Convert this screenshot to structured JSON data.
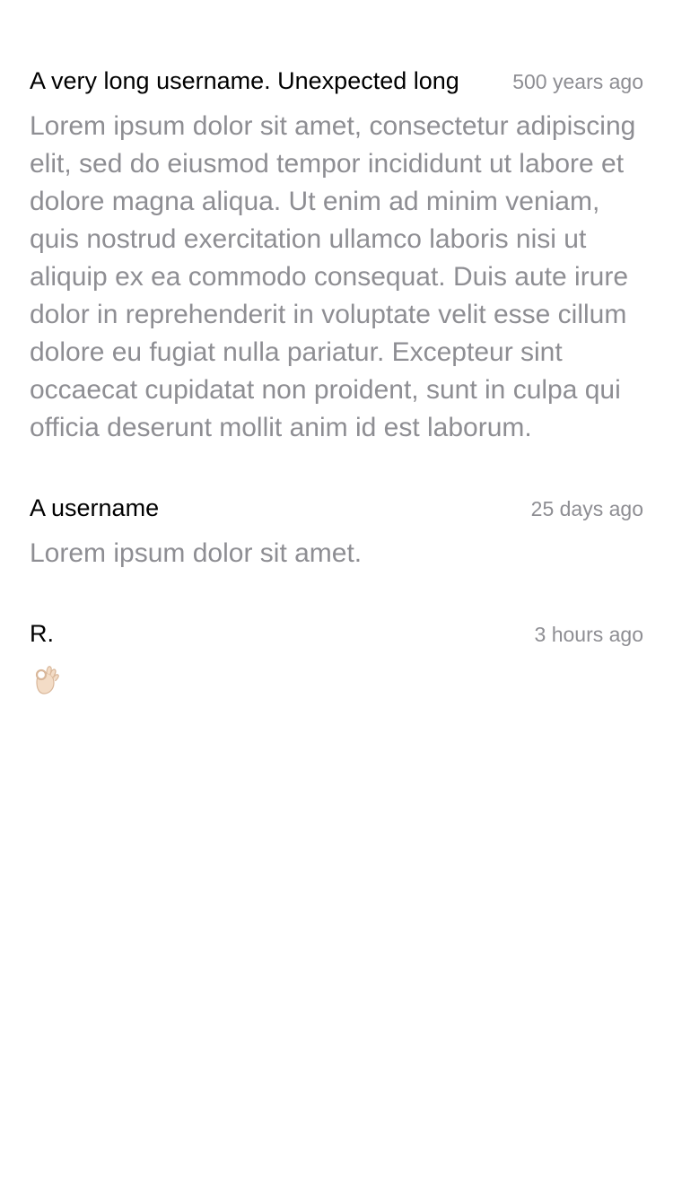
{
  "comments": [
    {
      "username": "A very long username. Unexpected long",
      "timestamp": "500 years ago",
      "body": "Lorem ipsum dolor sit amet, consectetur adipiscing elit, sed do eiusmod tempor incididunt ut labore et dolore magna aliqua. Ut enim ad minim veniam, quis nostrud exercitation ullamco laboris nisi ut aliquip ex ea commodo consequat. Duis aute irure dolor in reprehenderit in voluptate velit esse cillum dolore eu fugiat nulla pariatur. Excepteur sint occaecat cupidatat non proident, sunt in culpa qui officia deserunt mollit anim id est laborum."
    },
    {
      "username": "A username",
      "timestamp": "25 days ago",
      "body": "Lorem ipsum dolor sit amet."
    },
    {
      "username": "R.",
      "timestamp": "3 hours ago",
      "body_icon": "ok-hand-emoji-icon"
    }
  ],
  "colors": {
    "username": "#000000",
    "muted_text": "#8e8e93",
    "background": "#ffffff"
  }
}
